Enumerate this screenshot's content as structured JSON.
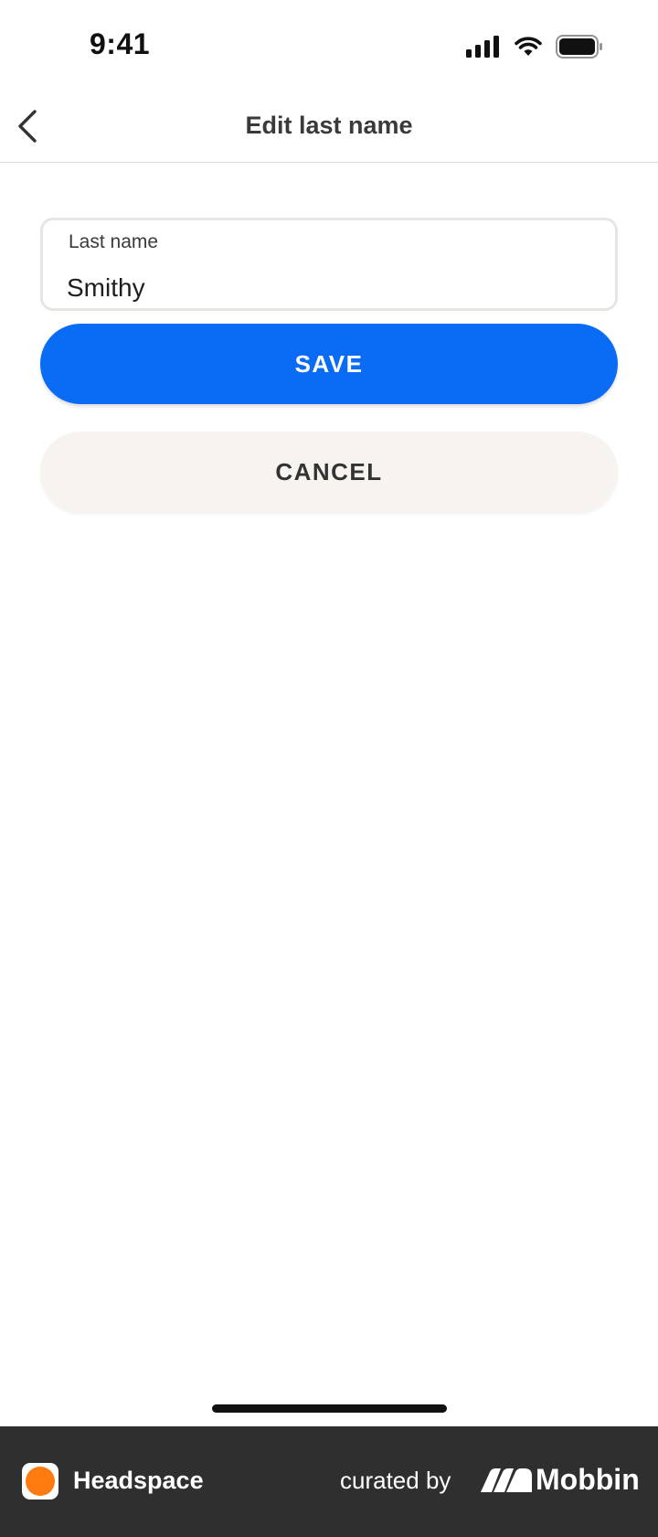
{
  "status_bar": {
    "time": "9:41",
    "icons": [
      "cellular-signal-icon",
      "wifi-icon",
      "battery-icon"
    ]
  },
  "header": {
    "title": "Edit last name",
    "back_icon": "chevron-left-icon"
  },
  "form": {
    "last_name": {
      "label": "Last name",
      "value": "Smithy"
    }
  },
  "actions": {
    "save_label": "SAVE",
    "cancel_label": "CANCEL"
  },
  "footer": {
    "app_name": "Headspace",
    "curated_by": "curated by",
    "brand": "Mobbin"
  },
  "colors": {
    "primary": "#0a6cf5",
    "secondary_button": "#f7f4f0",
    "app_accent": "#ff7a0f",
    "footer_bg": "#2f2f2f"
  }
}
